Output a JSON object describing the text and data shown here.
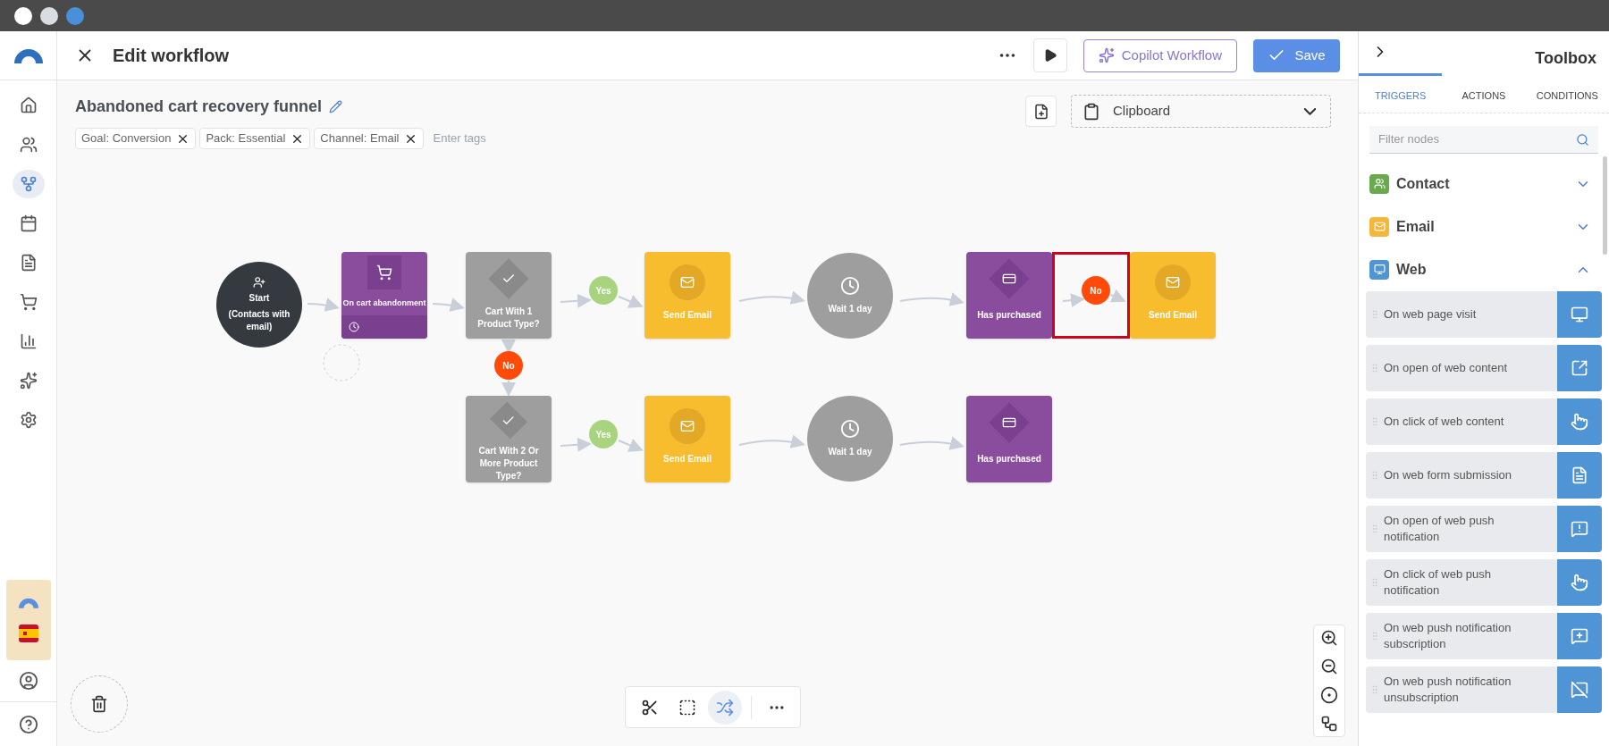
{
  "header": {
    "title": "Edit workflow",
    "copilot_button": "Copilot Workflow",
    "save_button": "Save"
  },
  "sidebar": {
    "items": [
      {
        "selected": false
      },
      {
        "selected": false
      },
      {
        "selected": true
      },
      {
        "selected": false
      },
      {
        "selected": false
      },
      {
        "selected": false
      },
      {
        "selected": false
      },
      {
        "selected": false
      },
      {
        "selected": false
      }
    ]
  },
  "workflow": {
    "name": "Abandoned cart recovery funnel",
    "tags": [
      {
        "label": "Goal: Conversion"
      },
      {
        "label": "Pack: Essential"
      },
      {
        "label": "Channel: Email"
      }
    ],
    "tag_placeholder": "Enter tags"
  },
  "clipboard": {
    "label": "Clipboard"
  },
  "nodes": [
    {
      "kind": "start",
      "label": "Start",
      "sublabel": "(Contacts with email)"
    },
    {
      "kind": "trigger",
      "label": "On cart abandonment"
    },
    {
      "kind": "condition",
      "label": "Cart With 1 Product Type?"
    },
    {
      "kind": "email",
      "label": "Send Email"
    },
    {
      "kind": "wait",
      "label": "Wait 1 day"
    },
    {
      "kind": "purchase",
      "label": "Has purchased"
    },
    {
      "kind": "email",
      "label": "Send Email"
    },
    {
      "kind": "condition",
      "label": "Cart With 2 Or More Product Type?"
    },
    {
      "kind": "email",
      "label": "Send Email"
    },
    {
      "kind": "wait",
      "label": "Wait 1 day"
    },
    {
      "kind": "purchase",
      "label": "Has purchased"
    }
  ],
  "connectors": [
    {
      "kind": "yes",
      "label": "Yes",
      "selected": false
    },
    {
      "kind": "no",
      "label": "No",
      "selected": true
    },
    {
      "kind": "no",
      "label": "No",
      "selected": false
    },
    {
      "kind": "yes",
      "label": "Yes",
      "selected": false
    }
  ],
  "tools": [
    {
      "selected": false
    },
    {
      "selected": false
    },
    {
      "selected": true
    }
  ],
  "toolbox": {
    "title": "Toolbox",
    "tabs": [
      {
        "label": "TRIGGERS",
        "selected": true
      },
      {
        "label": "ACTIONS",
        "selected": false
      },
      {
        "label": "CONDITIONS",
        "selected": false
      }
    ],
    "filter_placeholder": "Filter nodes",
    "categories": [
      {
        "name": "Contact",
        "color": "#6aaa4f",
        "expanded": false
      },
      {
        "name": "Email",
        "color": "#f4b73a",
        "expanded": false
      },
      {
        "name": "Web",
        "color": "#4f94d4",
        "expanded": true,
        "items": [
          {
            "label": "On web page visit"
          },
          {
            "label": "On open of web content"
          },
          {
            "label": "On click of web content"
          },
          {
            "label": "On web form submission"
          },
          {
            "label": "On open of web push notification"
          },
          {
            "label": "On click of web push notification"
          },
          {
            "label": "On web push notification subscription"
          },
          {
            "label": "On web push notification unsubscription"
          }
        ]
      }
    ]
  }
}
